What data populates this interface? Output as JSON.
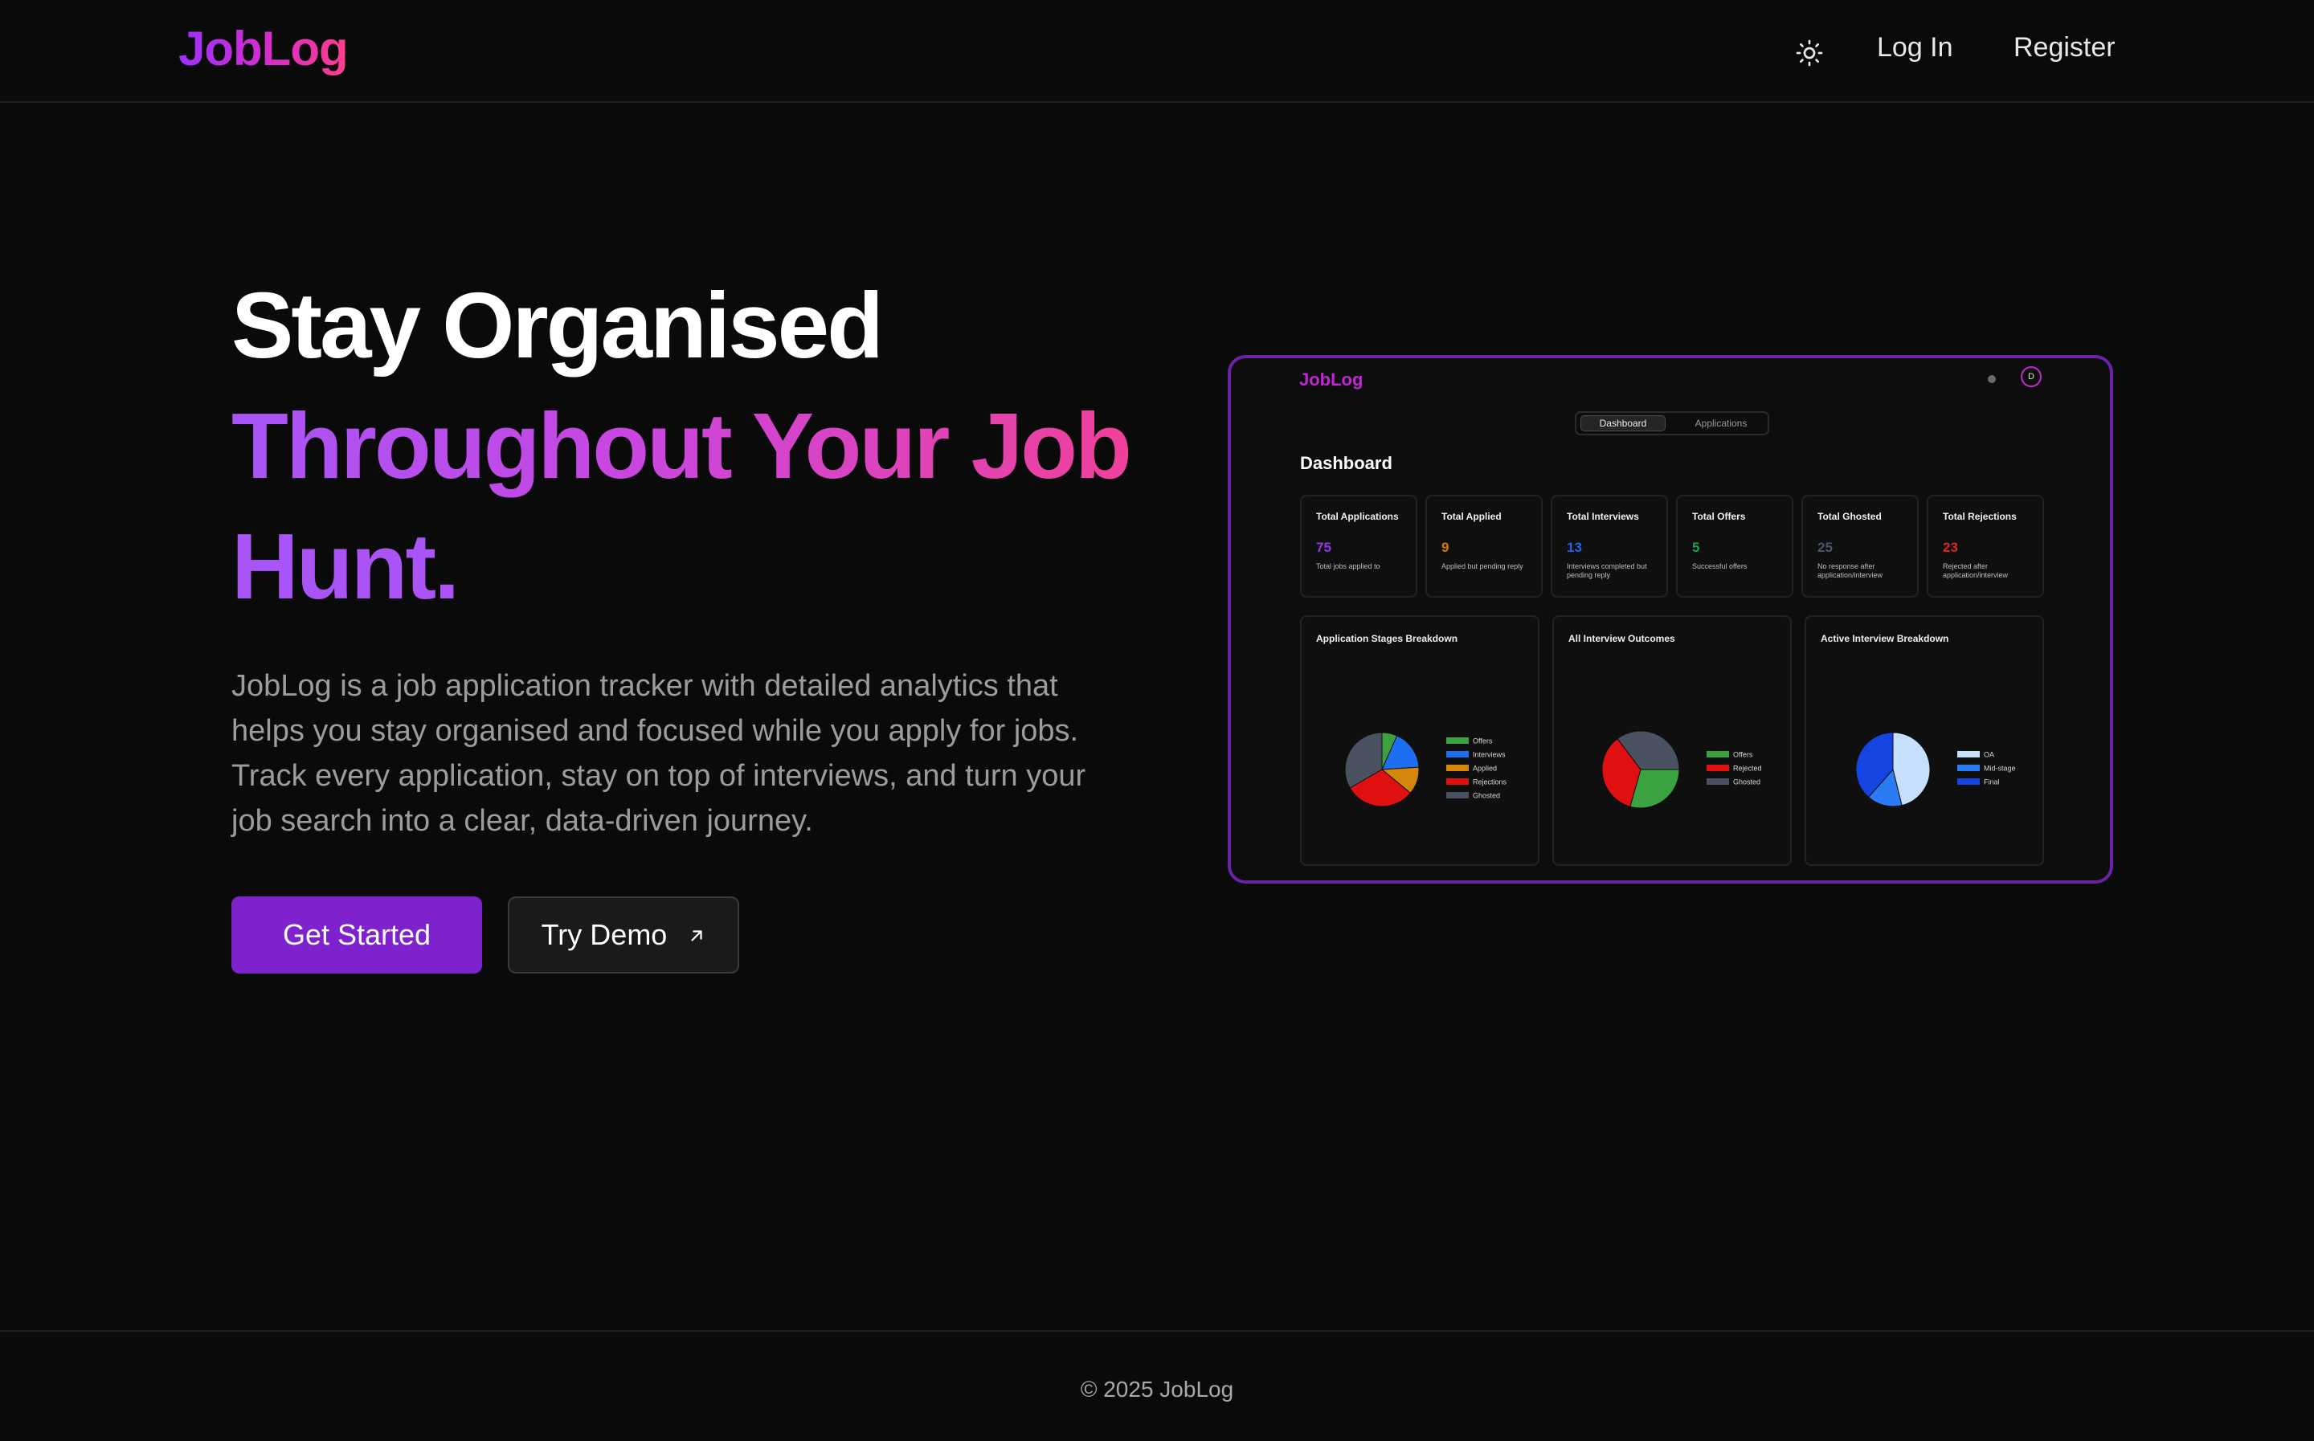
{
  "nav": {
    "logo": "JobLog",
    "theme_icon": "sun-icon",
    "login": "Log In",
    "register": "Register"
  },
  "hero": {
    "title_line1": "Stay Organised",
    "title_line2": "Throughout Your Job",
    "title_line3": "Hunt.",
    "description": "JobLog is a job application tracker with detailed analytics that helps you stay organised and focused while you apply for jobs. Track every application, stay on top of interviews, and turn your job search into a clear, data-driven journey.",
    "primary_button": "Get Started",
    "secondary_button": "Try Demo",
    "secondary_icon": "arrow-up-right-icon"
  },
  "preview": {
    "logo": "JobLog",
    "avatar_initial": "D",
    "tabs": [
      "Dashboard",
      "Applications"
    ],
    "title": "Dashboard",
    "stats": [
      {
        "label": "Total Applications",
        "value": "75",
        "sub": "Total jobs applied to",
        "color": "#9333ea"
      },
      {
        "label": "Total Applied",
        "value": "9",
        "sub": "Applied but pending reply",
        "color": "#d97706"
      },
      {
        "label": "Total Interviews",
        "value": "13",
        "sub": "Interviews completed but pending reply",
        "color": "#2563eb"
      },
      {
        "label": "Total Offers",
        "value": "5",
        "sub": "Successful offers",
        "color": "#16a34a"
      },
      {
        "label": "Total Ghosted",
        "value": "25",
        "sub": "No response after application/interview",
        "color": "#4b5563"
      },
      {
        "label": "Total Rejections",
        "value": "23",
        "sub": "Rejected after application/interview",
        "color": "#dc2626"
      }
    ]
  },
  "chart_data": [
    {
      "type": "pie",
      "title": "Application Stages Breakdown",
      "categories": [
        "Offers",
        "Interviews",
        "Applied",
        "Rejections",
        "Ghosted"
      ],
      "values": [
        5,
        13,
        9,
        23,
        25
      ],
      "colors": [
        "#3aa33f",
        "#1d6ff2",
        "#d4870b",
        "#e01010",
        "#4a5160"
      ]
    },
    {
      "type": "pie",
      "title": "All Interview Outcomes",
      "categories": [
        "Offers",
        "Rejected",
        "Ghosted"
      ],
      "values": [
        5,
        6,
        6
      ],
      "colors": [
        "#3aa33f",
        "#e01010",
        "#4a5160"
      ]
    },
    {
      "type": "pie",
      "title": "Active Interview Breakdown",
      "categories": [
        "OA",
        "Mid-stage",
        "Final"
      ],
      "values": [
        6,
        2,
        5
      ],
      "colors": [
        "#c6dffc",
        "#2b7bf5",
        "#1545e0"
      ]
    }
  ],
  "footer": {
    "copyright": "© 2025 JobLog"
  }
}
